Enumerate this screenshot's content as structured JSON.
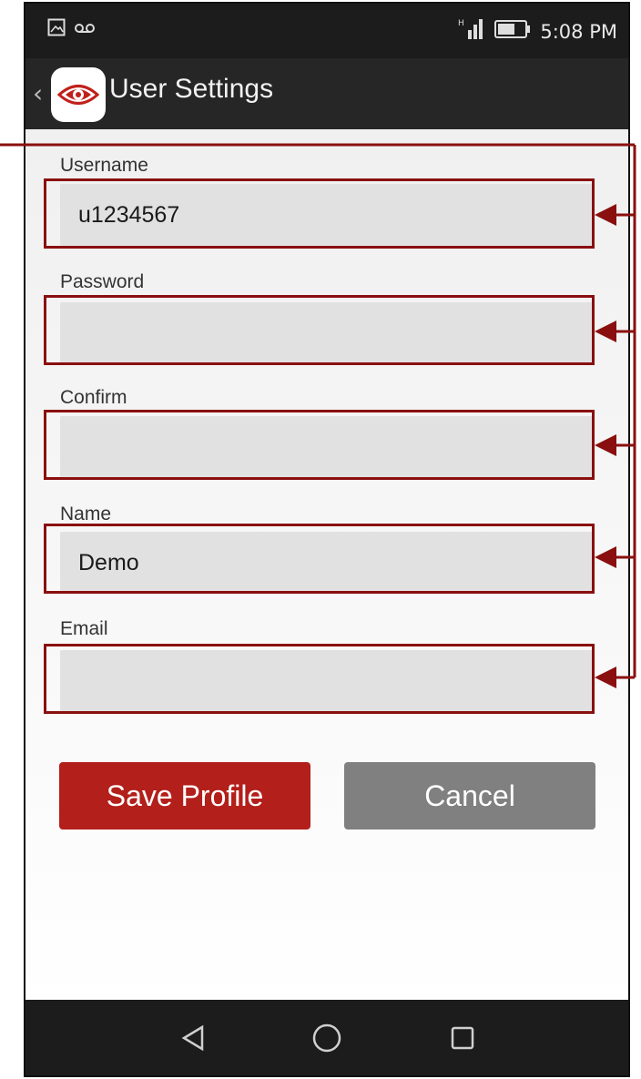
{
  "status_bar": {
    "time": "5:08 PM",
    "left_icons": [
      "image-icon",
      "voicemail-icon"
    ],
    "right_icons": [
      "signal-icon",
      "battery-icon"
    ]
  },
  "app_bar": {
    "title": "User Settings",
    "logo_icon": "eye-logo-icon"
  },
  "form": {
    "fields": [
      {
        "label": "Username",
        "value": "u1234567"
      },
      {
        "label": "Password",
        "value": ""
      },
      {
        "label": "Confirm",
        "value": ""
      },
      {
        "label": "Name",
        "value": "Demo"
      },
      {
        "label": "Email",
        "value": ""
      }
    ]
  },
  "buttons": {
    "save_label": "Save Profile",
    "cancel_label": "Cancel"
  },
  "nav_bar": {
    "icons": [
      "back-triangle-icon",
      "home-circle-icon",
      "recents-square-icon"
    ]
  },
  "colors": {
    "save_button": "#b31f1a",
    "cancel_button": "#808080",
    "annotation": "#8a0f0f",
    "input_bg": "#e1e1e1"
  }
}
